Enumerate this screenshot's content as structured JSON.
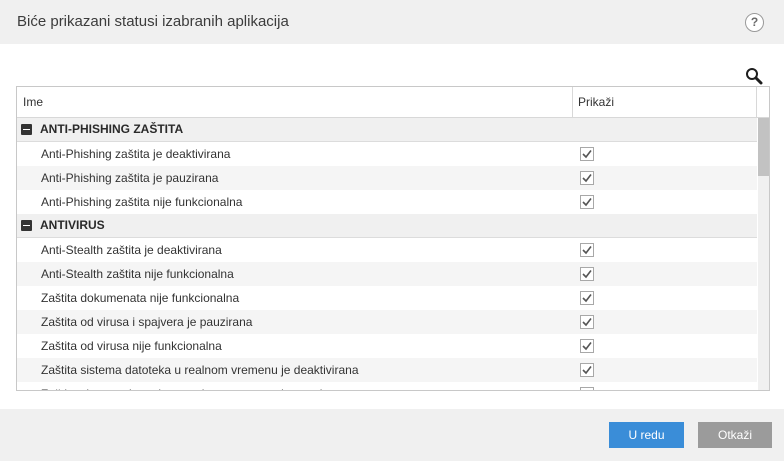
{
  "dialog": {
    "title": "Biće prikazani statusi izabranih aplikacija",
    "help_label": "?"
  },
  "table": {
    "columns": [
      "Ime",
      "Prikaži"
    ],
    "groups": [
      {
        "label": "ANTI-PHISHING ZAŠTITA",
        "items": [
          {
            "label": "Anti-Phishing zaštita je deaktivirana",
            "checked": true
          },
          {
            "label": "Anti-Phishing zaštita je pauzirana",
            "checked": true
          },
          {
            "label": "Anti-Phishing zaštita nije funkcionalna",
            "checked": true
          }
        ]
      },
      {
        "label": "ANTIVIRUS",
        "items": [
          {
            "label": "Anti-Stealth zaštita je deaktivirana",
            "checked": true
          },
          {
            "label": "Anti-Stealth zaštita nije funkcionalna",
            "checked": true
          },
          {
            "label": "Zaštita dokumenata nije funkcionalna",
            "checked": true
          },
          {
            "label": "Zaštita od virusa i spajvera je pauzirana",
            "checked": true
          },
          {
            "label": "Zaštita od virusa nije funkcionalna",
            "checked": true
          },
          {
            "label": "Zaštita sistema datoteka u realnom vremenu je deaktivirana",
            "checked": true
          },
          {
            "label": "Zaštita sistema datoteka u realnom vremenu je pauzirana",
            "checked": true
          }
        ]
      }
    ]
  },
  "footer": {
    "ok_label": "U redu",
    "cancel_label": "Otkaži"
  },
  "colors": {
    "primary_button": "#3a8dd8",
    "secondary_button": "#9b9b9b",
    "chrome_background": "#f0f0f0"
  },
  "icons": {
    "search": "search-icon",
    "collapse": "collapse-minus-icon",
    "check": "check-icon"
  }
}
